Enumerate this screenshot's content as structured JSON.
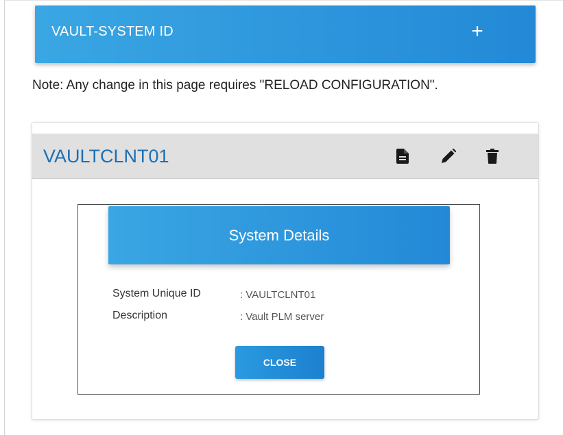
{
  "header": {
    "title": "VAULT-SYSTEM ID",
    "add_icon": "plus-icon",
    "accent_color": "#2a8fdc"
  },
  "note": "Note: Any change in this page requires \"RELOAD CONFIGURATION\".",
  "card": {
    "title": "VAULTCLNT01",
    "title_color": "#1d6fb3",
    "actions": [
      {
        "icon": "document-icon"
      },
      {
        "icon": "pencil-icon"
      },
      {
        "icon": "trash-icon"
      }
    ]
  },
  "modal": {
    "title": "System Details",
    "fields": [
      {
        "label": "System Unique ID",
        "value": ": VAULTCLNT01"
      },
      {
        "label": "Description",
        "value": ": Vault PLM server"
      }
    ],
    "close_label": "CLOSE"
  }
}
